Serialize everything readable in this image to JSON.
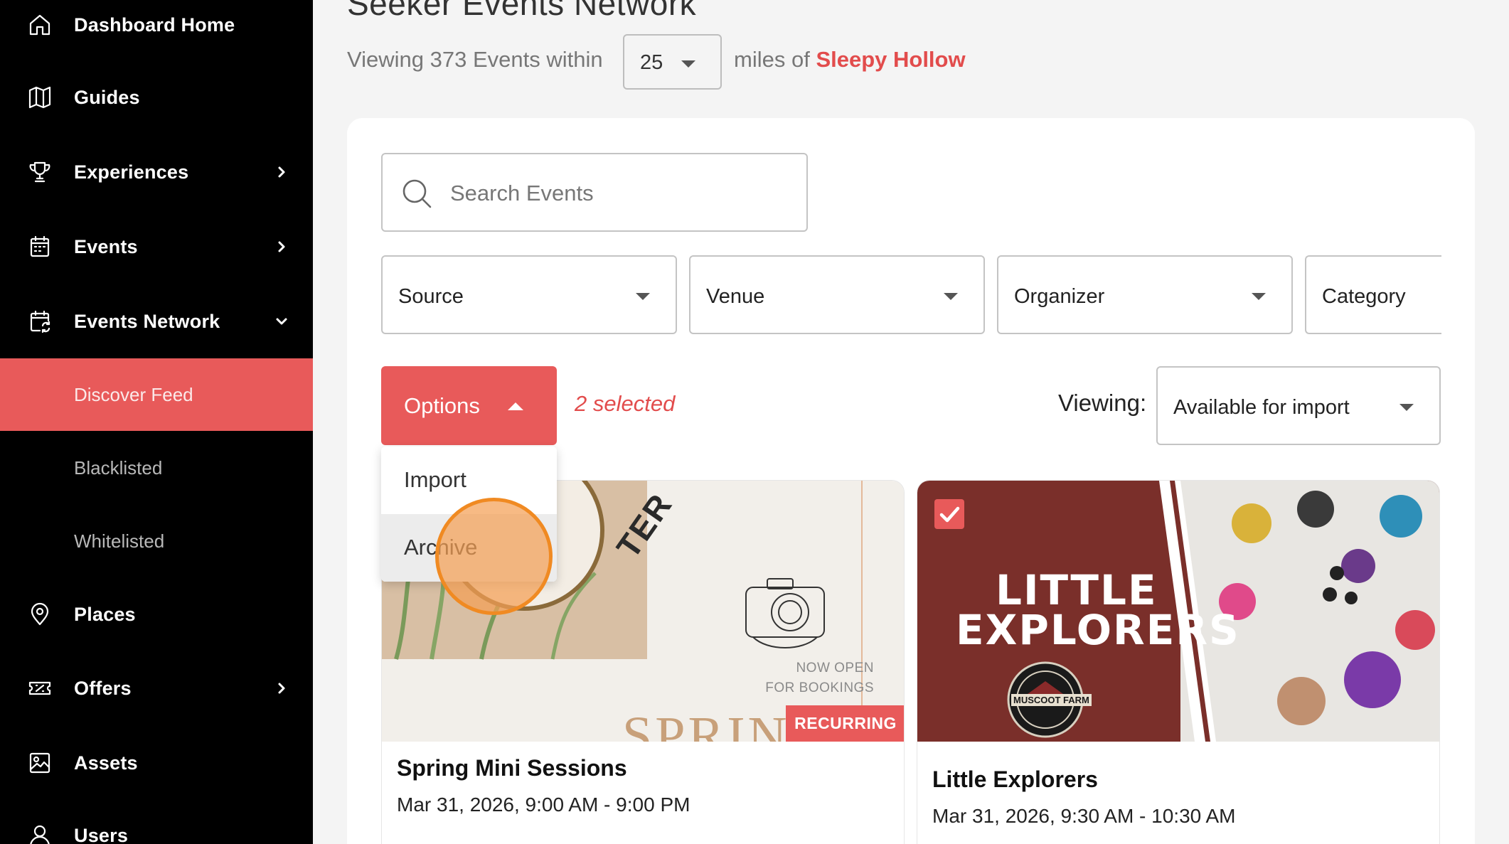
{
  "sidebar": {
    "items": [
      {
        "label": "Dashboard Home",
        "icon": "home-icon"
      },
      {
        "label": "Guides",
        "icon": "map-icon"
      },
      {
        "label": "Experiences",
        "icon": "trophy-icon",
        "chevron": "chevron-right-icon"
      },
      {
        "label": "Events",
        "icon": "calendar-icon",
        "chevron": "chevron-right-icon"
      },
      {
        "label": "Events Network",
        "icon": "calendar-sync-icon",
        "chevron": "chevron-down-icon"
      },
      {
        "label": "Places",
        "icon": "map-pin-icon"
      },
      {
        "label": "Offers",
        "icon": "ticket-icon",
        "chevron": "chevron-right-icon"
      },
      {
        "label": "Assets",
        "icon": "image-icon"
      },
      {
        "label": "Users",
        "icon": "user-icon"
      }
    ],
    "sub_items": [
      {
        "label": "Discover Feed",
        "active": true
      },
      {
        "label": "Blacklisted",
        "active": false
      },
      {
        "label": "Whitelisted",
        "active": false
      }
    ],
    "active_color": "#e85a5a"
  },
  "header": {
    "title": "Seeker Events Network",
    "viewing_prefix": "Viewing 373 Events within",
    "miles_value": "25",
    "miles_suffix": "miles of",
    "location": "Sleepy Hollow"
  },
  "search": {
    "placeholder": "Search Events",
    "icon": "search-icon"
  },
  "filters": [
    {
      "label": "Source"
    },
    {
      "label": "Venue"
    },
    {
      "label": "Organizer"
    },
    {
      "label": "Category"
    }
  ],
  "toolbar": {
    "options_label": "Options",
    "selected_text": "2 selected",
    "viewing_label": "Viewing:",
    "viewing_value": "Available for import"
  },
  "options_menu": {
    "items": [
      "Import",
      "Archive"
    ],
    "hovered": "Archive"
  },
  "cards": [
    {
      "title": "Spring Mini Sessions",
      "date": "Mar 31, 2026, 9:00 AM - 9:00 PM",
      "badge": "RECURRING",
      "checked": false,
      "image_text": {
        "line1": "NOW OPEN",
        "line2": "FOR BOOKINGS",
        "word": "SPRIN",
        "arc": "TER"
      }
    },
    {
      "title": "Little Explorers",
      "date": "Mar 31, 2026, 9:30 AM - 10:30 AM",
      "checked": true,
      "image_text": {
        "line1": "LITTLE",
        "line2": "EXPLORERS",
        "seal": "MUSCOOT FARM"
      }
    }
  ],
  "colors": {
    "accent": "#e85a5a",
    "sidebar_bg": "#000000",
    "page_bg": "#f4f4f4",
    "click_indicator": "#f08a22"
  }
}
